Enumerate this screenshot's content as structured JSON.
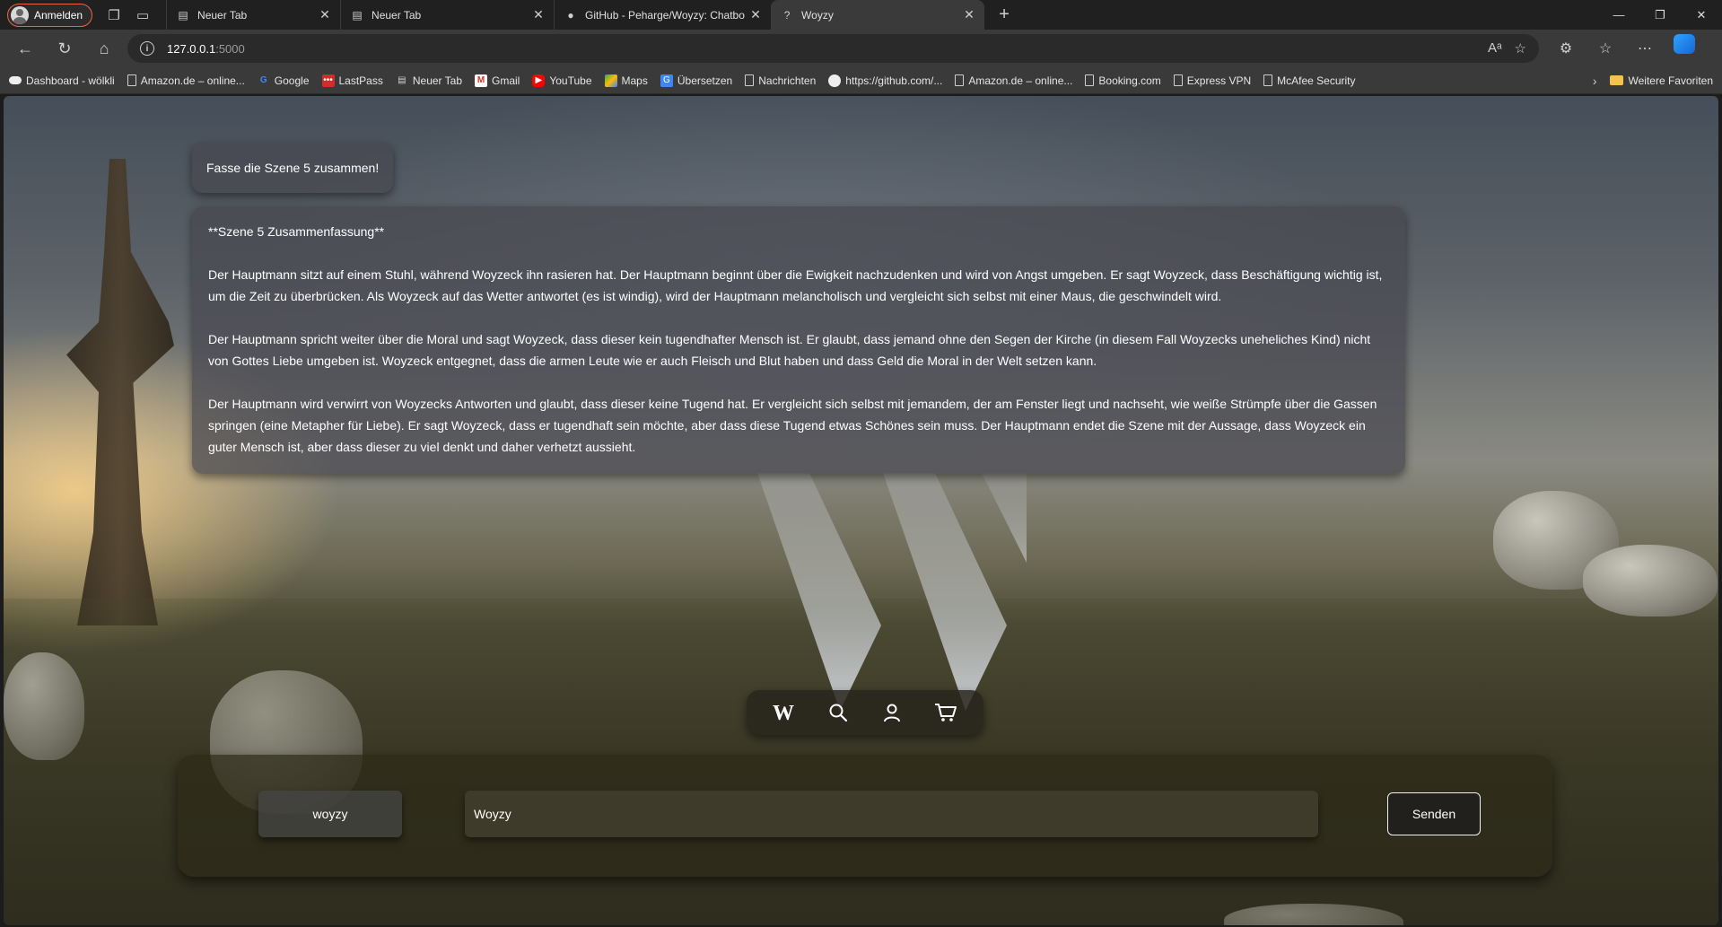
{
  "browser": {
    "profile_label": "Anmelden",
    "tabs": [
      {
        "title": "Neuer Tab",
        "icon": "new-tab-icon"
      },
      {
        "title": "Neuer Tab",
        "icon": "new-tab-icon"
      },
      {
        "title": "GitHub - Peharge/Woyzy: Chatbo",
        "icon": "github-icon"
      },
      {
        "title": "Woyzy",
        "icon": "woyzy-favicon"
      }
    ],
    "address": {
      "host": "127.0.0.1",
      "port": ":5000"
    },
    "bookmarks": [
      {
        "label": "Dashboard - wölkli",
        "icon": "cloud-icon"
      },
      {
        "label": "Amazon.de – online...",
        "icon": "page-icon"
      },
      {
        "label": "Google",
        "icon": "google-icon"
      },
      {
        "label": "LastPass",
        "icon": "lastpass-icon"
      },
      {
        "label": "Neuer Tab",
        "icon": "new-tab-icon"
      },
      {
        "label": "Gmail",
        "icon": "gmail-icon"
      },
      {
        "label": "YouTube",
        "icon": "youtube-icon"
      },
      {
        "label": "Maps",
        "icon": "maps-icon"
      },
      {
        "label": "Übersetzen",
        "icon": "translate-icon"
      },
      {
        "label": "Nachrichten",
        "icon": "page-icon"
      },
      {
        "label": "https://github.com/...",
        "icon": "github-icon"
      },
      {
        "label": "Amazon.de – online...",
        "icon": "page-icon"
      },
      {
        "label": "Booking.com",
        "icon": "page-icon"
      },
      {
        "label": "Express VPN",
        "icon": "page-icon"
      },
      {
        "label": "McAfee Security",
        "icon": "page-icon"
      }
    ],
    "other_favorites": "Weitere Favoriten"
  },
  "chat": {
    "user_message": "Fasse die Szene 5 zusammen!",
    "bot_title": "**Szene 5 Zusammenfassung**",
    "bot_paragraphs": [
      "Der Hauptmann sitzt auf einem Stuhl, während Woyzeck ihn rasieren hat. Der Hauptmann beginnt über die Ewigkeit nachzudenken und wird von Angst umgeben. Er sagt Woyzeck, dass Beschäftigung wichtig ist, um die Zeit zu überbrücken. Als Woyzeck auf das Wetter antwortet (es ist windig), wird der Hauptmann melancholisch und vergleicht sich selbst mit einer Maus, die geschwindelt wird.",
      "Der Hauptmann spricht weiter über die Moral und sagt Woyzeck, dass dieser kein tugendhafter Mensch ist. Er glaubt, dass jemand ohne den Segen der Kirche (in diesem Fall Woyzecks uneheliches Kind) nicht von Gottes Liebe umgeben ist. Woyzeck entgegnet, dass die armen Leute wie er auch Fleisch und Blut haben und dass Geld die Moral in der Welt setzen kann.",
      "Der Hauptmann wird verwirrt von Woyzecks Antworten und glaubt, dass dieser keine Tugend hat. Er vergleicht sich selbst mit jemandem, der am Fenster liegt und nachseht, wie weiße Strümpfe über die Gassen springen (eine Metapher für Liebe). Er sagt Woyzeck, dass er tugendhaft sein möchte, aber dass diese Tugend etwas Schönes sein muss. Der Hauptmann endet die Szene mit der Aussage, dass Woyzeck ein guter Mensch ist, aber dass dieser zu viel denkt und daher verhetzt aussieht."
    ]
  },
  "iconbar": {
    "icons": [
      "woyzy-logo-icon",
      "search-icon",
      "user-icon",
      "cart-icon"
    ]
  },
  "input": {
    "model_label": "woyzy",
    "message_value": "Woyzy",
    "send_label": "Senden"
  }
}
